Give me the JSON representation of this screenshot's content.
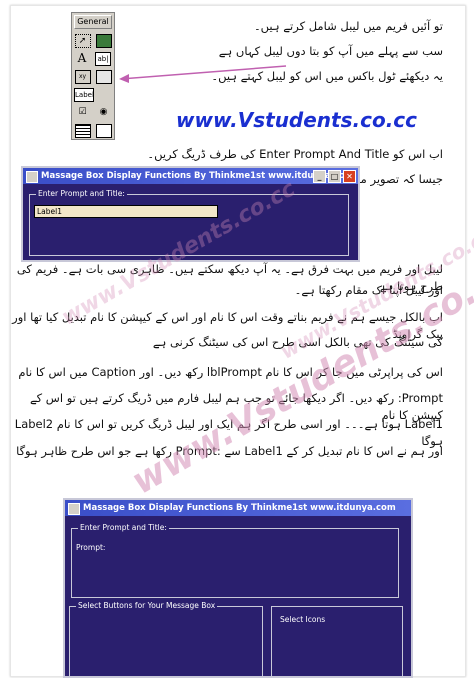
{
  "watermark": "www.Vstudents.co.cc",
  "site_url": "www.Vstudents.co.cc",
  "urdu_lines": [
    "تو آئیں فریم میں لیبل شامل کرتے ہیں۔",
    "سب سے پہلے میں آپ کو بتا دوں لیبل کہاں ہے",
    "یہ دیکھئے ٹول باکس میں اس کو لیبل کہتے ہیں۔",
    "اب اس کو Enter Prompt And Title کی طرف ڈریگ کریں۔",
    "جیسا کہ تصویر میں ہے",
    "لیبل اور فریم میں بہت فرق ہے۔ یہ آپ دیکھ سکتے ہیں۔ ظاہری سی بات ہے۔ فریم کی طرح ہوتا ہے",
    "اور لیبل اپنا اک مقام رکھتا ہے۔",
    "اب بالکل جیسے ہم نے فریم بناتے وقت اس کا نام اور اس کے کیپشن کا نام تبدیل کیا تھا اور بیک گراونڈ",
    "کی سیٹنگ کی تھی بالکل اسی طرح اس کی سیٹنگ کرنی ہے",
    "اس کی پراپرٹی میں جا کر اس کا نام lblPrompt رکھ دیں۔ اور Caption میں اس کا نام",
    "Prompt: رکھ دیں۔ اگر دیکھا جائے تو جب ہم لیبل فارم میں ڈریگ کرتے ہیں تو اس کے کیپشن کا نام",
    "Label1 ہوتا ہے۔۔۔ اور اسی طرح اگر ہم ایک اور لیبل ڈریگ کریں تو اس کا نام Label2 ہوگا",
    "اور ہم نے اس کا نام تبدیل کر کے Label1 سے :Prompt رکھا ہے جو اس طرح ظاہر ہوگا"
  ],
  "toolbox": {
    "title": "General",
    "rows": [
      [
        "pointer-icon",
        "picture-icon"
      ],
      [
        "A",
        "ab|"
      ],
      [
        "frame-icon",
        "Label"
      ],
      [
        "checkbox-icon",
        "option-icon"
      ],
      [
        "combo-icon",
        "list-icon"
      ],
      [
        "hscroll-icon",
        "vscroll-icon"
      ]
    ],
    "label_tool": "Label",
    "text_a": "A",
    "textbox": "ab|"
  },
  "window1": {
    "title": "Massage Box Display Functions  By Thinkme1st www.itdunya.com",
    "frame_legend": "Enter Prompt and Title:",
    "label_text": "Label1"
  },
  "window2": {
    "title": "Massage Box Display Functions  By Thinkme1st www.itdunya.com",
    "frame1_legend": "Enter Prompt and Title:",
    "prompt_text": "Prompt:",
    "frame2_legend": "Select Buttons for Your Message Box",
    "frame3_legend": "Select Icons"
  },
  "colors": {
    "vb_background": "#2a1f6e",
    "titlebar": "#3a4ec8",
    "url_blue": "#1a2fd0",
    "watermark_pink": "#d58fb8"
  }
}
